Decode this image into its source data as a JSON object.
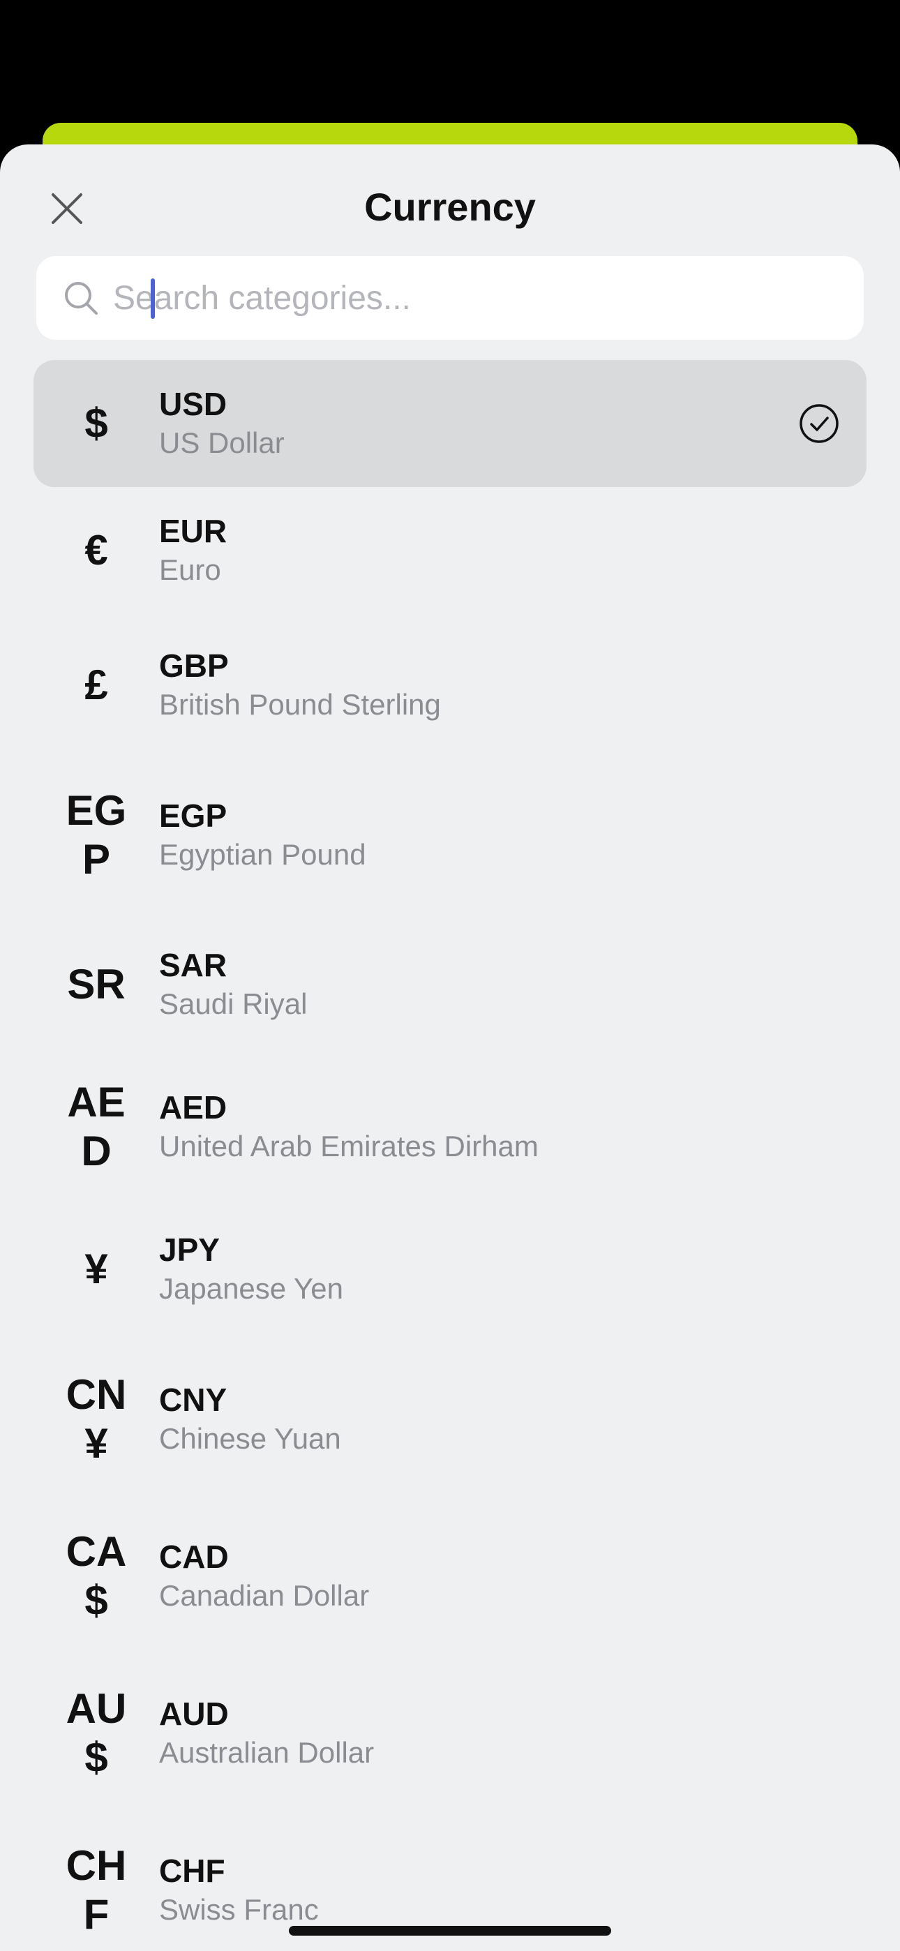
{
  "sheet": {
    "title": "Currency",
    "accent_color": "#b6d80c"
  },
  "search": {
    "placeholder": "Search categories...",
    "value": ""
  },
  "currencies": [
    {
      "symbol": "$",
      "code": "USD",
      "name": "US Dollar",
      "selected": true
    },
    {
      "symbol": "€",
      "code": "EUR",
      "name": "Euro",
      "selected": false
    },
    {
      "symbol": "£",
      "code": "GBP",
      "name": "British Pound Sterling",
      "selected": false
    },
    {
      "symbol": "EGP",
      "code": "EGP",
      "name": "Egyptian Pound",
      "selected": false
    },
    {
      "symbol": "SR",
      "code": "SAR",
      "name": "Saudi Riyal",
      "selected": false
    },
    {
      "symbol": "AED",
      "code": "AED",
      "name": "United Arab Emirates Dirham",
      "selected": false
    },
    {
      "symbol": "¥",
      "code": "JPY",
      "name": "Japanese Yen",
      "selected": false
    },
    {
      "symbol": "CN¥",
      "code": "CNY",
      "name": "Chinese Yuan",
      "selected": false
    },
    {
      "symbol": "CA$",
      "code": "CAD",
      "name": "Canadian Dollar",
      "selected": false
    },
    {
      "symbol": "AU$",
      "code": "AUD",
      "name": "Australian Dollar",
      "selected": false
    },
    {
      "symbol": "CHF",
      "code": "CHF",
      "name": "Swiss Franc",
      "selected": false
    }
  ]
}
